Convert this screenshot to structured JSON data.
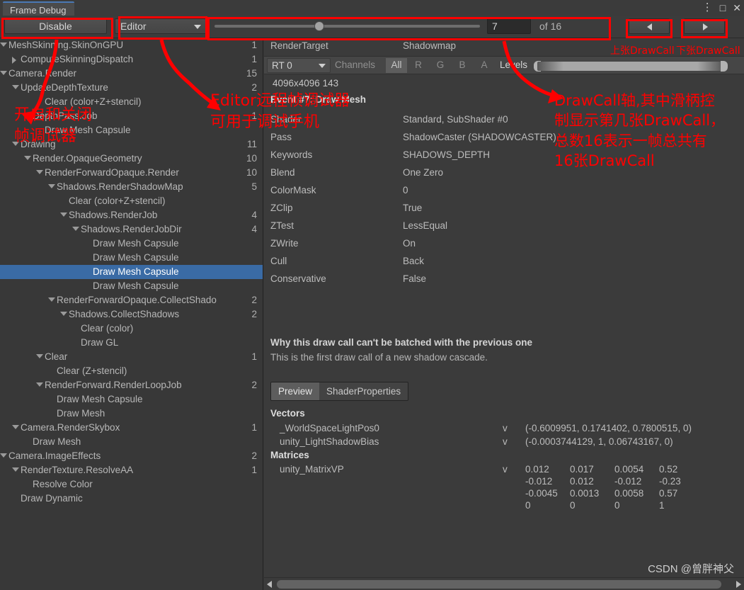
{
  "window": {
    "tab_title": "Frame Debug",
    "menu_icon": "⋮",
    "maximize_icon": "□",
    "close_icon": "✕"
  },
  "toolbar": {
    "disable_label": "Disable",
    "target_dropdown": "Editor",
    "event_value": "7",
    "event_total": "of 16",
    "prev_title": "prev-draw-call",
    "next_title": "next-draw-call"
  },
  "tree": {
    "rows": [
      {
        "label": "MeshSkinning.SkinOnGPU",
        "indent": 0,
        "twirl": "open",
        "count": "1",
        "selected": false
      },
      {
        "label": "ComputeSkinningDispatch",
        "indent": 1,
        "twirl": "closed",
        "count": "1",
        "selected": false
      },
      {
        "label": "Camera.Render",
        "indent": 0,
        "twirl": "open",
        "count": "15",
        "selected": false
      },
      {
        "label": "UpdateDepthTexture",
        "indent": 1,
        "twirl": "open",
        "count": "2",
        "selected": false
      },
      {
        "label": "Clear (color+Z+stencil)",
        "indent": 3,
        "twirl": "none",
        "count": "",
        "selected": false
      },
      {
        "label": "DepthPass.Job",
        "indent": 2,
        "twirl": "open",
        "count": "1",
        "selected": false
      },
      {
        "label": "Draw Mesh Capsule",
        "indent": 3,
        "twirl": "none",
        "count": "",
        "selected": false
      },
      {
        "label": "Drawing",
        "indent": 1,
        "twirl": "open",
        "count": "11",
        "selected": false
      },
      {
        "label": "Render.OpaqueGeometry",
        "indent": 2,
        "twirl": "open",
        "count": "10",
        "selected": false
      },
      {
        "label": "RenderForwardOpaque.Render",
        "indent": 3,
        "twirl": "open",
        "count": "10",
        "selected": false
      },
      {
        "label": "Shadows.RenderShadowMap",
        "indent": 4,
        "twirl": "open",
        "count": "5",
        "selected": false
      },
      {
        "label": "Clear (color+Z+stencil)",
        "indent": 5,
        "twirl": "none",
        "count": "",
        "selected": false
      },
      {
        "label": "Shadows.RenderJob",
        "indent": 5,
        "twirl": "open",
        "count": "4",
        "selected": false
      },
      {
        "label": "Shadows.RenderJobDir",
        "indent": 6,
        "twirl": "open",
        "count": "4",
        "selected": false
      },
      {
        "label": "Draw Mesh Capsule",
        "indent": 7,
        "twirl": "none",
        "count": "",
        "selected": false
      },
      {
        "label": "Draw Mesh Capsule",
        "indent": 7,
        "twirl": "none",
        "count": "",
        "selected": false
      },
      {
        "label": "Draw Mesh Capsule",
        "indent": 7,
        "twirl": "none",
        "count": "",
        "selected": true
      },
      {
        "label": "Draw Mesh Capsule",
        "indent": 7,
        "twirl": "none",
        "count": "",
        "selected": false
      },
      {
        "label": "RenderForwardOpaque.CollectShado",
        "indent": 4,
        "twirl": "open",
        "count": "2",
        "selected": false
      },
      {
        "label": "Shadows.CollectShadows",
        "indent": 5,
        "twirl": "open",
        "count": "2",
        "selected": false
      },
      {
        "label": "Clear (color)",
        "indent": 6,
        "twirl": "none",
        "count": "",
        "selected": false
      },
      {
        "label": "Draw GL",
        "indent": 6,
        "twirl": "none",
        "count": "",
        "selected": false
      },
      {
        "label": "Clear",
        "indent": 3,
        "twirl": "open",
        "count": "1",
        "selected": false
      },
      {
        "label": "Clear (Z+stencil)",
        "indent": 4,
        "twirl": "none",
        "count": "",
        "selected": false
      },
      {
        "label": "RenderForward.RenderLoopJob",
        "indent": 3,
        "twirl": "open",
        "count": "2",
        "selected": false
      },
      {
        "label": "Draw Mesh Capsule",
        "indent": 4,
        "twirl": "none",
        "count": "",
        "selected": false
      },
      {
        "label": "Draw Mesh",
        "indent": 4,
        "twirl": "none",
        "count": "",
        "selected": false
      },
      {
        "label": "Camera.RenderSkybox",
        "indent": 1,
        "twirl": "open",
        "count": "1",
        "selected": false
      },
      {
        "label": "Draw Mesh",
        "indent": 2,
        "twirl": "none",
        "count": "",
        "selected": false
      },
      {
        "label": "Camera.ImageEffects",
        "indent": 0,
        "twirl": "open",
        "count": "2",
        "selected": false
      },
      {
        "label": "RenderTexture.ResolveAA",
        "indent": 1,
        "twirl": "open",
        "count": "1",
        "selected": false
      },
      {
        "label": "Resolve Color",
        "indent": 2,
        "twirl": "none",
        "count": "",
        "selected": false
      },
      {
        "label": "Draw Dynamic",
        "indent": 1,
        "twirl": "none",
        "count": "",
        "selected": false
      }
    ]
  },
  "detail": {
    "render_target_key": "RenderTarget",
    "render_target_value": "Shadowmap",
    "rt_dropdown": "RT 0",
    "channels_label": "Channels",
    "channel_buttons": [
      {
        "label": "All",
        "active": true
      },
      {
        "label": "R",
        "active": false
      },
      {
        "label": "G",
        "active": false
      },
      {
        "label": "B",
        "active": false
      },
      {
        "label": "A",
        "active": false
      }
    ],
    "levels_label": "Levels",
    "size_line": "4096x4096 143",
    "event_title": "Event #7: Draw Mesh",
    "properties": [
      {
        "key": "Shader",
        "value": "Standard, SubShader #0"
      },
      {
        "key": "Pass",
        "value": "ShadowCaster (SHADOWCASTER)"
      },
      {
        "key": "Keywords",
        "value": "SHADOWS_DEPTH"
      },
      {
        "key": "Blend",
        "value": "One Zero"
      },
      {
        "key": "ColorMask",
        "value": "0"
      },
      {
        "key": "ZClip",
        "value": "True"
      },
      {
        "key": "ZTest",
        "value": "LessEqual"
      },
      {
        "key": "ZWrite",
        "value": "On"
      },
      {
        "key": "Cull",
        "value": "Back"
      },
      {
        "key": "Conservative",
        "value": "False"
      }
    ],
    "why_title": "Why this draw call can't be batched with the previous one",
    "why_body": "This is the first draw call of a new shadow cascade.",
    "tabs": [
      {
        "label": "Preview",
        "active": true
      },
      {
        "label": "ShaderProperties",
        "active": false
      }
    ],
    "vectors_title": "Vectors",
    "vectors": [
      {
        "name": "_WorldSpaceLightPos0",
        "flag": "v",
        "value": "(-0.6009951, 0.1741402, 0.7800515, 0)"
      },
      {
        "name": "unity_LightShadowBias",
        "flag": "v",
        "value": "(-0.0003744129, 1, 0.06743167, 0)"
      }
    ],
    "matrices_title": "Matrices",
    "matrix_name": "unity_MatrixVP",
    "matrix_flag": "v",
    "matrix_rows": [
      [
        "0.012",
        "0.017",
        "0.0054",
        "0.52"
      ],
      [
        "-0.012",
        "0.012",
        "-0.012",
        "-0.23"
      ],
      [
        "-0.0045",
        "0.0013",
        "0.0058",
        "0.57"
      ],
      [
        "0",
        "0",
        "0",
        "1"
      ]
    ]
  },
  "footer": {
    "watermark": "CSDN @曾胖神父"
  },
  "annotations": {
    "accent": "#ff0000",
    "disable_note": "开启和关闭\n帧调试器",
    "editor_note": "Editor远程帧调试器\n可用于调试手机",
    "prev_note": "上张DrawCall",
    "next_note": "下张DrawCall",
    "slider_note": "DrawCall轴,其中滑柄控\n制显示第几张DrawCall，\n总数16表示一帧总共有\n16张DrawCall"
  }
}
